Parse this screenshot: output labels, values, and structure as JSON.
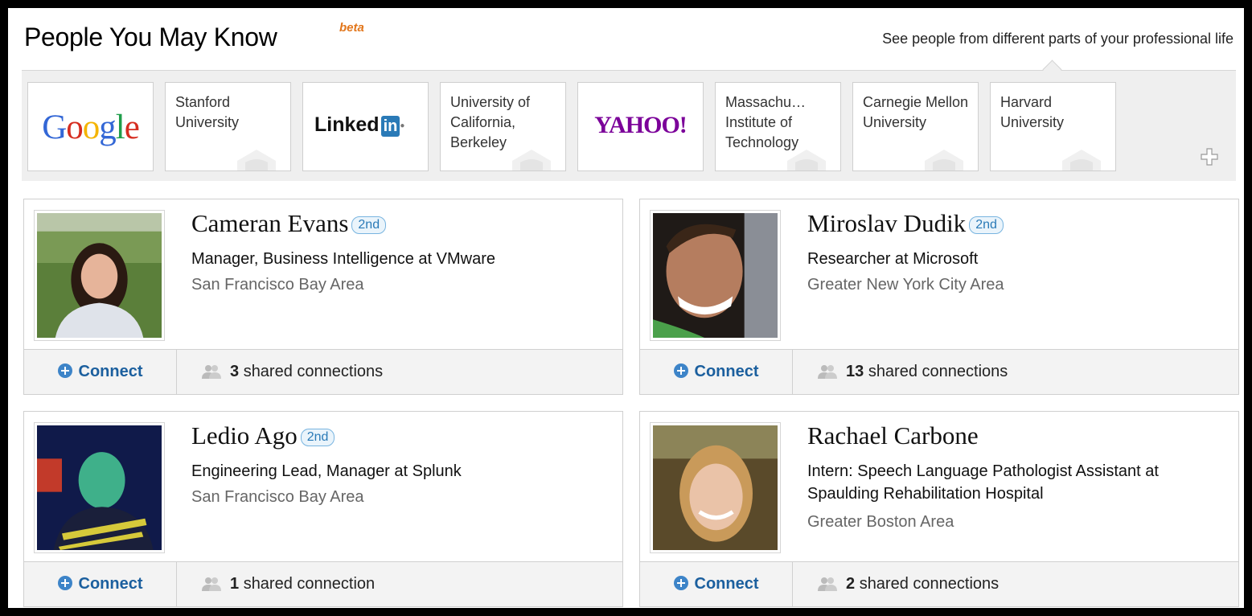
{
  "header": {
    "title": "People You May Know",
    "beta": "beta",
    "link": "See people from different parts of your professional life"
  },
  "colors": {
    "link_blue": "#1b5f9e",
    "badge_blue": "#2a7ab7",
    "beta_orange": "#e2761b",
    "yahoo_purple": "#7b0099",
    "strip_bg": "#efefef"
  },
  "filters": [
    {
      "label": "Google",
      "kind": "logo",
      "icon": "google-logo"
    },
    {
      "label": "Stanford University",
      "kind": "text"
    },
    {
      "label": "Linked",
      "logo_suffix": "in",
      "kind": "logo",
      "icon": "linkedin-logo"
    },
    {
      "label": "University of California, Berkeley",
      "kind": "text"
    },
    {
      "label": "YAHOO!",
      "kind": "logo",
      "icon": "yahoo-logo"
    },
    {
      "label": "Massachu… Institute of Technology",
      "kind": "text"
    },
    {
      "label": "Carnegie Mellon University",
      "kind": "text"
    },
    {
      "label": "Harvard University",
      "kind": "text"
    }
  ],
  "people": [
    {
      "name": "Cameran Evans",
      "degree": "2nd",
      "headline": "Manager, Business Intelligence at VMware",
      "location": "San Francisco Bay Area",
      "connect": "Connect",
      "shared_count": "3",
      "shared_text": "shared connections"
    },
    {
      "name": "Miroslav Dudik",
      "degree": "2nd",
      "headline": "Researcher at Microsoft",
      "location": "Greater New York City Area",
      "connect": "Connect",
      "shared_count": "13",
      "shared_text": "shared connections"
    },
    {
      "name": "Ledio Ago",
      "degree": "2nd",
      "headline": "Engineering Lead, Manager at Splunk",
      "location": "San Francisco Bay Area",
      "connect": "Connect",
      "shared_count": "1",
      "shared_text": "shared connection"
    },
    {
      "name": "Rachael Carbone",
      "degree": "",
      "headline": "Intern: Speech Language Pathologist Assistant at Spaulding Rehabilitation Hospital",
      "location": "Greater Boston Area",
      "connect": "Connect",
      "shared_count": "2",
      "shared_text": "shared connections"
    }
  ]
}
